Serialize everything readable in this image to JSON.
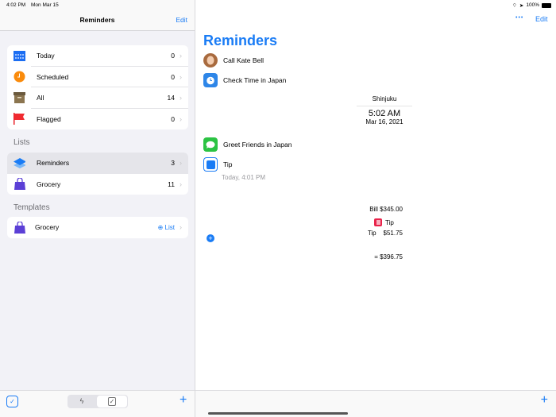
{
  "status_bar": {
    "time": "4:02 PM",
    "date": "Mon Mar 15",
    "battery": "100%"
  },
  "sidebar": {
    "title": "Reminders",
    "edit": "Edit",
    "smart_lists": [
      {
        "label": "Today",
        "count": "0",
        "icon": "calendar-icon"
      },
      {
        "label": "Scheduled",
        "count": "0",
        "icon": "clock-icon"
      },
      {
        "label": "All",
        "count": "14",
        "icon": "archive-box-icon"
      },
      {
        "label": "Flagged",
        "count": "0",
        "icon": "flag-icon"
      }
    ],
    "lists_header": "Lists",
    "lists": [
      {
        "label": "Reminders",
        "count": "3",
        "icon": "layers-icon",
        "selected": true
      },
      {
        "label": "Grocery",
        "count": "11",
        "icon": "shopping-bag-icon"
      }
    ],
    "templates_header": "Templates",
    "templates": [
      {
        "label": "Grocery",
        "action": "List",
        "icon": "shopping-bag-icon"
      }
    ]
  },
  "main": {
    "title": "Reminders",
    "more": "•••",
    "edit": "Edit",
    "items": [
      {
        "label": "Call Kate Bell",
        "icon": "contact-avatar-icon"
      },
      {
        "label": "Check Time in Japan",
        "icon": "clock-app-icon"
      },
      {
        "label": "Greet Friends in Japan",
        "icon": "messages-icon"
      },
      {
        "label": "Tip",
        "icon": "stop-square-icon",
        "subtitle": "Today, 4:01 PM"
      }
    ],
    "time_card": {
      "city": "Shinjuku",
      "time": "5:02 AM",
      "date": "Mar 16, 2021"
    },
    "tip_card": {
      "bill": "Bill $345.00",
      "tip": "Tip    $51.75",
      "total": "= $396.75",
      "app": "Tip"
    }
  },
  "colors": {
    "accent": "#1a7cf5",
    "sidebar_bg": "#f2f2f7"
  }
}
